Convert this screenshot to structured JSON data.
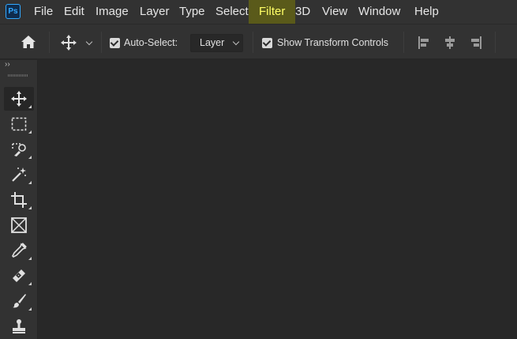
{
  "app": {
    "logo_text": "Ps"
  },
  "menu": {
    "items": [
      "File",
      "Edit",
      "Image",
      "Layer",
      "Type",
      "Select",
      "Filter",
      "3D",
      "View",
      "Window",
      "Help"
    ],
    "active": "Filter"
  },
  "options_bar": {
    "auto_select_label": "Auto-Select:",
    "auto_select_checked": true,
    "auto_select_target": "Layer",
    "show_transform_label": "Show Transform Controls",
    "show_transform_checked": true
  },
  "tools": [
    "move-tool",
    "rectangular-marquee-tool",
    "object-selection-tool",
    "magic-wand-tool",
    "crop-tool",
    "frame-tool",
    "eyedropper-tool",
    "spot-healing-brush-tool",
    "brush-tool",
    "clone-stamp-tool"
  ],
  "colors": {
    "accent": "#31a8ff",
    "highlight": "#ffff66",
    "chrome": "#323232",
    "canvas": "#282828"
  }
}
